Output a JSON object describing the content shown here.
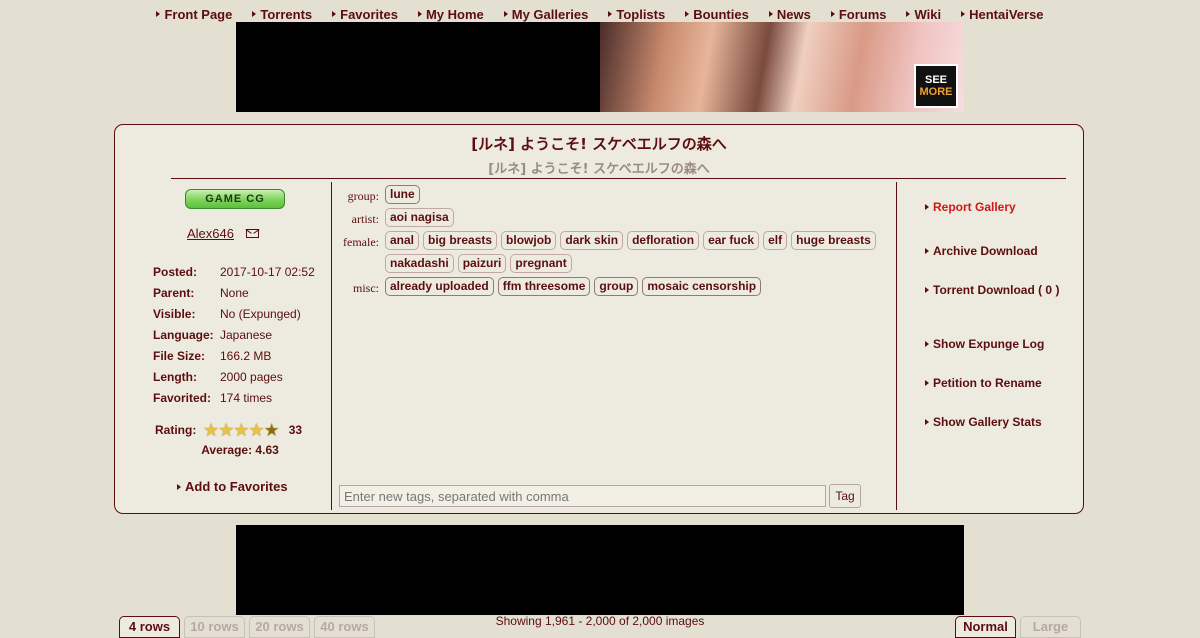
{
  "nav": {
    "items": [
      "Front Page",
      "Torrents",
      "Favorites",
      "My Home",
      "My Galleries",
      "Toplists",
      "Bounties",
      "News",
      "Forums",
      "Wiki",
      "HentaiVerse"
    ]
  },
  "ad_top": {
    "badge_line1": "SEE",
    "badge_line2": "MORE"
  },
  "gallery": {
    "title": "[ルネ] ようこそ! スケベエルフの森へ",
    "title_jpn": "[ルネ] ようこそ! スケベエルフの森へ",
    "category": "GAME CG",
    "uploader": "Alex646",
    "meta": [
      {
        "key": "Posted:",
        "value": "2017-10-17 02:52"
      },
      {
        "key": "Parent:",
        "value": "None"
      },
      {
        "key": "Visible:",
        "value": "No (Expunged)"
      },
      {
        "key": "Language:",
        "value": "Japanese"
      },
      {
        "key": "File Size:",
        "value": "166.2 MB"
      },
      {
        "key": "Length:",
        "value": "2000 pages"
      },
      {
        "key": "Favorited:",
        "value": "174 times"
      }
    ],
    "rating": {
      "label": "Rating:",
      "stars": 4.5,
      "count": "33",
      "average": "Average: 4.63"
    },
    "add_favorites": "Add to Favorites"
  },
  "tags": [
    {
      "ns": "group:",
      "items": [
        "lune"
      ]
    },
    {
      "ns": "artist:",
      "items": [
        "aoi nagisa"
      ]
    },
    {
      "ns": "female:",
      "items": [
        "anal",
        "big breasts",
        "blowjob",
        "dark skin",
        "defloration",
        "ear fuck",
        "elf",
        "huge breasts",
        "nakadashi",
        "paizuri",
        "pregnant"
      ]
    },
    {
      "ns": "misc:",
      "items": [
        "already uploaded",
        "ffm threesome",
        "group",
        "mosaic censorship"
      ]
    }
  ],
  "tag_input": {
    "placeholder": "Enter new tags, separated with comma",
    "button": "Tag"
  },
  "actions": {
    "report": "Report Gallery",
    "archive": "Archive Download",
    "torrent": "Torrent Download ( 0 )",
    "expunge": "Show Expunge Log",
    "rename": "Petition to Rename",
    "stats": "Show Gallery Stats"
  },
  "bottom": {
    "rows": [
      "4 rows",
      "10 rows",
      "20 rows",
      "40 rows"
    ],
    "showing": "Showing 1,961 - 2,000 of 2,000 images",
    "sizes": [
      "Normal",
      "Large"
    ]
  },
  "colors": {
    "background": "#e3e0d1",
    "panel": "#edebdf",
    "text": "#5c0d11",
    "report": "#d01818",
    "category_green": "#7dd45a"
  }
}
